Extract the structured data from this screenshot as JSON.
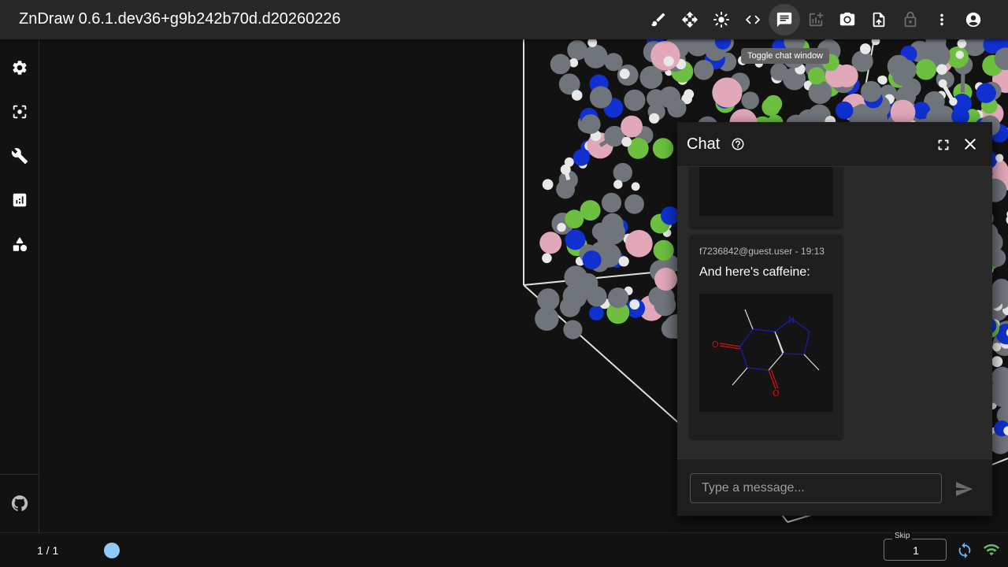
{
  "app": {
    "title": "ZnDraw 0.6.1.dev36+g9b242b70d.d20260226"
  },
  "toolbar": {
    "tooltip": "Toggle chat window",
    "icons": [
      "brush-icon",
      "move-icon",
      "brightness-icon",
      "code-icon",
      "chat-icon",
      "add-chart-icon",
      "camera-icon",
      "upload-file-icon",
      "lock-icon",
      "more-vert-icon",
      "account-icon"
    ]
  },
  "sidebar": {
    "icons": [
      "settings-icon",
      "center-focus-icon",
      "wrench-icon",
      "analytics-icon",
      "geometry-icon",
      "github-icon"
    ]
  },
  "chat": {
    "title": "Chat",
    "messages": [
      {
        "meta": "f7236842@guest.user - 19:13",
        "text": "And here's caffeine:"
      }
    ],
    "input_placeholder": "Type a message..."
  },
  "footer": {
    "frame": "1 / 1",
    "skip_label": "Skip",
    "skip_value": "1"
  },
  "colors": {
    "appbar": "#272727",
    "background": "#121212",
    "accent_blue": "#90caf9",
    "connected_green": "#66bb6a",
    "atom_carbon": "#70757c",
    "atom_hydrogen": "#e8e8e8",
    "atom_nitrogen": "#1030d0",
    "atom_chlorine": "#6cbf3f",
    "atom_boron": "#e0a8b8"
  }
}
